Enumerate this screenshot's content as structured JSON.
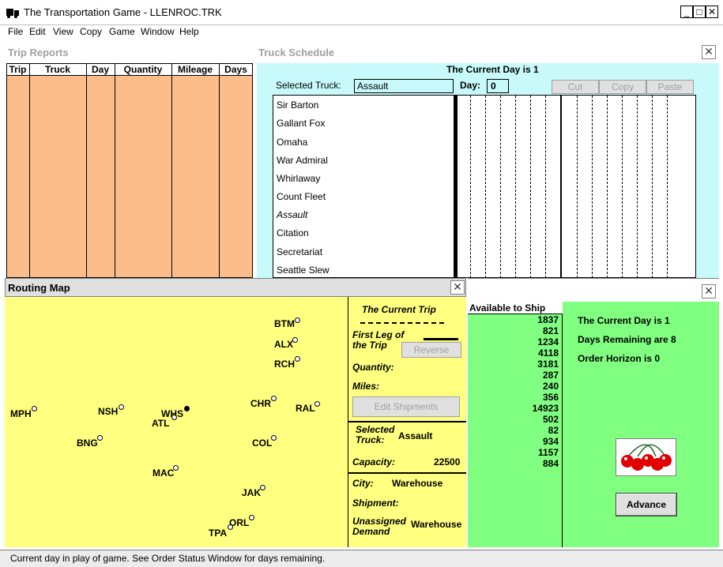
{
  "window": {
    "title": "The Transportation Game - LLENROC.TRK"
  },
  "menu": [
    "File",
    "Edit",
    "View",
    "Copy",
    "Game",
    "Window",
    "Help"
  ],
  "trip_reports": {
    "title": "Trip Reports",
    "columns": [
      "Trip",
      "Truck",
      "Day",
      "Quantity",
      "Mileage",
      "Days"
    ]
  },
  "schedule": {
    "title": "Truck Schedule",
    "current_day": "The Current Day is 1",
    "selected_truck_label": "Selected Truck:",
    "selected_truck": "Assault",
    "day_label": "Day:",
    "day_value": "0",
    "cut": "Cut",
    "copy": "Copy",
    "paste": "Paste",
    "trucks": [
      "Sir Barton",
      "Gallant Fox",
      "Omaha",
      "War Admiral",
      "Whirlaway",
      "Count Fleet",
      "Assault",
      "Citation",
      "Secretariat",
      "Seattle Slew"
    ]
  },
  "map": {
    "title": "Routing Map",
    "cities": [
      "BTM",
      "ALX",
      "RCH",
      "CHR",
      "RAL",
      "MPH",
      "NSH",
      "WHS",
      "ATL",
      "BNG",
      "COL",
      "MAC",
      "JAK",
      "ORL",
      "TPA"
    ],
    "current_trip": "The Current Trip",
    "first_leg": "First Leg of the Trip",
    "reverse": "Reverse",
    "quantity_label": "Quantity:",
    "miles_label": "Miles:",
    "edit_shipments": "Edit Shipments",
    "selected_truck_label": "Selected Truck:",
    "selected_truck": "Assault",
    "capacity_label": "Capacity:",
    "capacity": "22500",
    "city_label": "City:",
    "city_value": "Warehouse",
    "shipment_label": "Shipment:",
    "unassigned_label": "Unassigned Demand",
    "unassigned_value": "Warehouse"
  },
  "order_status": {
    "available_header": "Available to Ship",
    "values": [
      "1837",
      "821",
      "1234",
      "4118",
      "3181",
      "287",
      "240",
      "356",
      "14923",
      "502",
      "82",
      "934",
      "1157",
      "884"
    ],
    "current_day": "The Current Day is 1",
    "days_remaining": "Days Remaining are 8",
    "order_horizon": "Order Horizon is 0",
    "advance": "Advance"
  },
  "status_bar": "Current day in play of game. See Order Status Window for days remaining."
}
